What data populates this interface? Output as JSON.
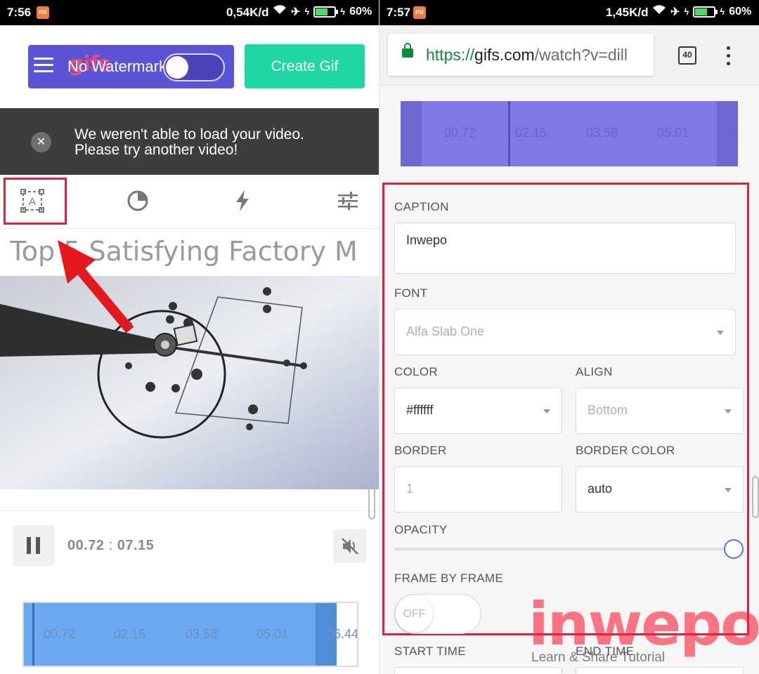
{
  "left": {
    "status": {
      "time": "7:56",
      "net_speed": "0,54K/d",
      "battery": "60%",
      "battery_level": 0.6
    },
    "header": {
      "logo_text": "gifs",
      "watermark_label": "No Watermark",
      "create_label": "Create Gif"
    },
    "error": {
      "close_glyph": "✕",
      "line1": "We weren't able to load your video.",
      "line2": "Please try another video!"
    },
    "tools": [
      "caption-tool",
      "crop-tool",
      "effects-tool",
      "adjust-tool"
    ],
    "video_title": "Top 5 Satisfying Factory M",
    "player": {
      "current": "00.72",
      "separator": ":",
      "total": "07.15"
    },
    "timeline": {
      "ticks": [
        "00.72",
        "02.15",
        "03.58",
        "05.01",
        "06.44"
      ]
    }
  },
  "right": {
    "status": {
      "time": "7:57",
      "net_speed": "1,45K/d",
      "battery": "60%",
      "battery_level": 0.6
    },
    "browser": {
      "url_scheme": "https://",
      "url_host": "gifs.com",
      "url_path": "/watch?v=dill",
      "tab_count": "40"
    },
    "timeline": {
      "ticks": [
        "00.72",
        "02.15",
        "03.58",
        "05.01",
        "0"
      ]
    },
    "form": {
      "caption_label": "CAPTION",
      "caption_value": "Inwepo",
      "font_label": "FONT",
      "font_value": "Alfa Slab One",
      "color_label": "COLOR",
      "color_value": "#ffffff",
      "align_label": "ALIGN",
      "align_value": "Bottom",
      "border_label": "BORDER",
      "border_placeholder": "1",
      "border_color_label": "BORDER COLOR",
      "border_color_value": "auto",
      "opacity_label": "OPACITY",
      "opacity_value": 1.0,
      "frame_label": "FRAME BY FRAME",
      "frame_toggle": "OFF",
      "start_label": "START TIME",
      "end_label": "END TIME"
    },
    "watermark": {
      "brand": "inwepo",
      "tagline": "Learn & Share Tutorial"
    }
  },
  "colors": {
    "brand_purple": "#5b54d6",
    "create_green": "#1fd6a4",
    "highlight_red": "#d9203c",
    "timeline_blue": "#6aa9ef",
    "timeline_purple": "#7e79e7",
    "secure_green": "#128a3c"
  }
}
